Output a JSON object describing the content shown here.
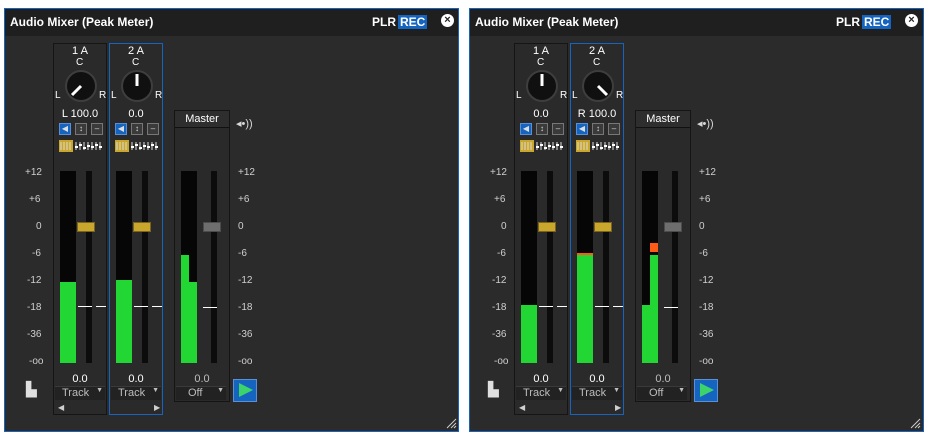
{
  "panels": [
    {
      "title": "Audio Mixer (Peak Meter)",
      "plr_label": "PLR",
      "rec_label": "REC",
      "channels": [
        {
          "name": "1 A",
          "pan_value": "L 100.0",
          "knob_c": "C",
          "knob_l": "L",
          "knob_r": "R",
          "gain": "0.0",
          "route": "Track",
          "meter_level": 0.42,
          "peak_level": 0,
          "fader_level": 0.5
        },
        {
          "name": "2 A",
          "pan_value": "0.0",
          "knob_c": "C",
          "knob_l": "L",
          "knob_r": "R",
          "gain": "0.0",
          "route": "Track",
          "meter_level": 0.43,
          "peak_level": 0,
          "fader_level": 0.5
        }
      ],
      "master": {
        "label": "Master",
        "gain": "0.0",
        "route": "Off",
        "meter_level": 0.56,
        "meter_level_right": 0.42
      }
    },
    {
      "title": "Audio Mixer (Peak Meter)",
      "plr_label": "PLR",
      "rec_label": "REC",
      "channels": [
        {
          "name": "1 A",
          "pan_value": "0.0",
          "knob_c": "C",
          "knob_l": "L",
          "knob_r": "R",
          "gain": "0.0",
          "route": "Track",
          "meter_level": 0.3,
          "peak_level": 0,
          "fader_level": 0.5
        },
        {
          "name": "2 A",
          "pan_value": "R 100.0",
          "knob_c": "C",
          "knob_l": "L",
          "knob_r": "R",
          "gain": "0.0",
          "route": "Track",
          "meter_level": 0.57,
          "peak_level": 0.01,
          "fader_level": 0.5
        },
        {
          "name": "2 A"
        }
      ],
      "master": {
        "label": "Master",
        "gain": "0.0",
        "route": "Off",
        "meter_level": 0.3,
        "meter_level_right": 0.6
      }
    }
  ],
  "scale_labels": [
    "+12",
    "+6",
    "0",
    "-6",
    "-12",
    "-18",
    "-36",
    "-oo"
  ],
  "icons": {
    "close": "close-icon",
    "speaker": "speaker-icon",
    "play": "play-icon",
    "meter_view": "meter-view-icon"
  },
  "colors": {
    "accent": "#1565c0",
    "meter_green": "#22d634",
    "meter_orange": "#ff5a16",
    "fader_gold": "#c9a72c",
    "panel_bg": "#2b2b2b"
  }
}
